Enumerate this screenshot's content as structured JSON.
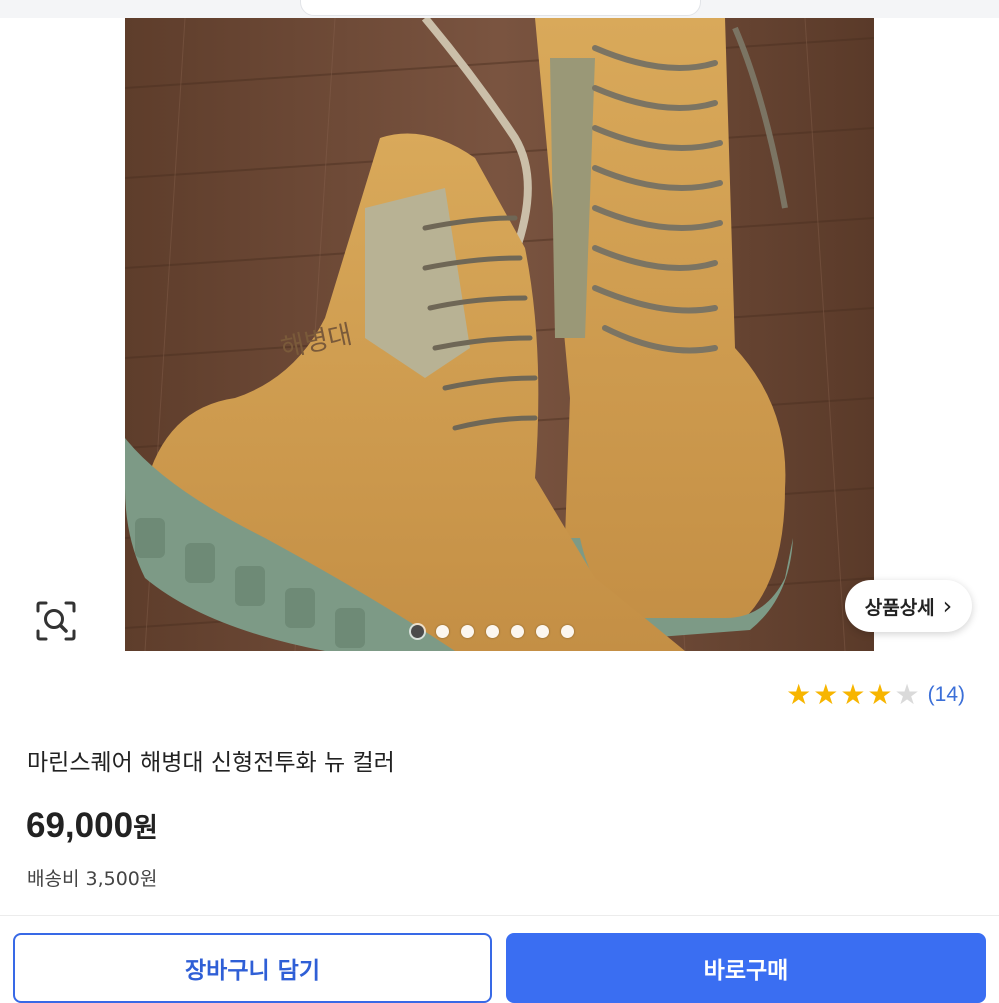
{
  "gallery": {
    "detail_label": "상품상세",
    "detail_chevron": "›",
    "zoom_icon": "search-zoom-icon",
    "dots_total": 7,
    "active_dot": 1,
    "photo_subject": "boots-photo",
    "boot_text": "해병대"
  },
  "rating": {
    "stars_filled": 4,
    "stars_total": 5,
    "review_count": "(14)",
    "star_color": "#f7b500"
  },
  "product": {
    "title": "마린스퀘어 해병대 신형전투화 뉴 컬러",
    "price_number": "69,000",
    "price_unit": "원",
    "shipping": "배송비 3,500원"
  },
  "actions": {
    "cart_label": "장바구니 담기",
    "buy_label": "바로구매",
    "accent_color": "#3a6ef2"
  }
}
